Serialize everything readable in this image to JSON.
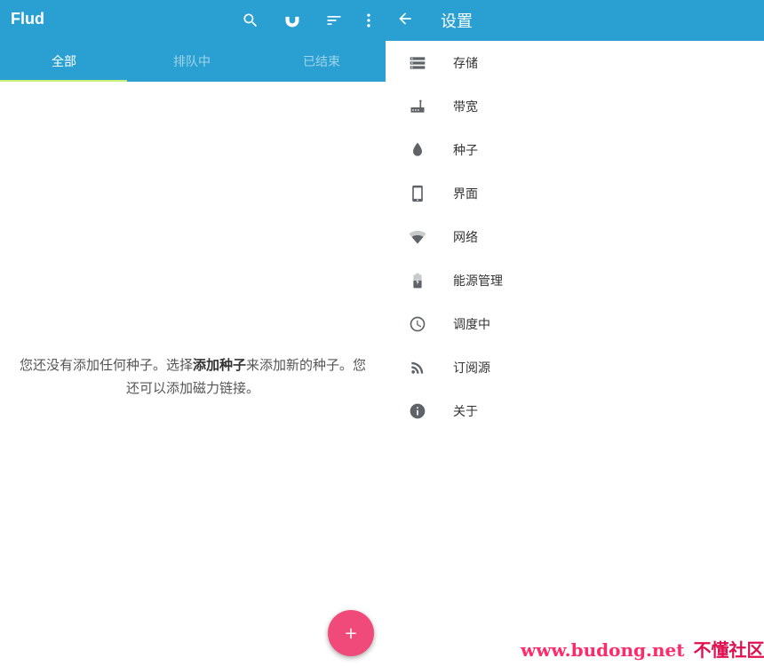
{
  "app": {
    "title": "Flud"
  },
  "toolbar": {
    "icons": [
      "search-icon",
      "magnet-icon",
      "sort-icon",
      "more-vert-icon"
    ]
  },
  "tabs": [
    {
      "label": "全部",
      "active": true
    },
    {
      "label": "排队中",
      "active": false
    },
    {
      "label": "已结束",
      "active": false
    }
  ],
  "empty_state": {
    "part1": "您还没有添加任何种子。选择",
    "bold": "添加种子",
    "part2": "来添加新的种子。您还可以添加磁力链接。"
  },
  "fab": {
    "label": "+"
  },
  "settings": {
    "title": "设置",
    "items": [
      {
        "label": "存储",
        "icon": "storage-icon"
      },
      {
        "label": "带宽",
        "icon": "router-icon"
      },
      {
        "label": "种子",
        "icon": "drop-icon"
      },
      {
        "label": "界面",
        "icon": "phone-icon"
      },
      {
        "label": "网络",
        "icon": "wifi-icon"
      },
      {
        "label": "能源管理",
        "icon": "battery-icon"
      },
      {
        "label": "调度中",
        "icon": "clock-icon"
      },
      {
        "label": "订阅源",
        "icon": "rss-icon"
      },
      {
        "label": "关于",
        "icon": "info-icon"
      }
    ]
  },
  "watermark": {
    "url": "www.budong.net",
    "cn": "不懂社区"
  },
  "colors": {
    "primary": "#2a9fd1",
    "accent": "#f04a7a",
    "tab_indicator": "#c8f07a"
  }
}
